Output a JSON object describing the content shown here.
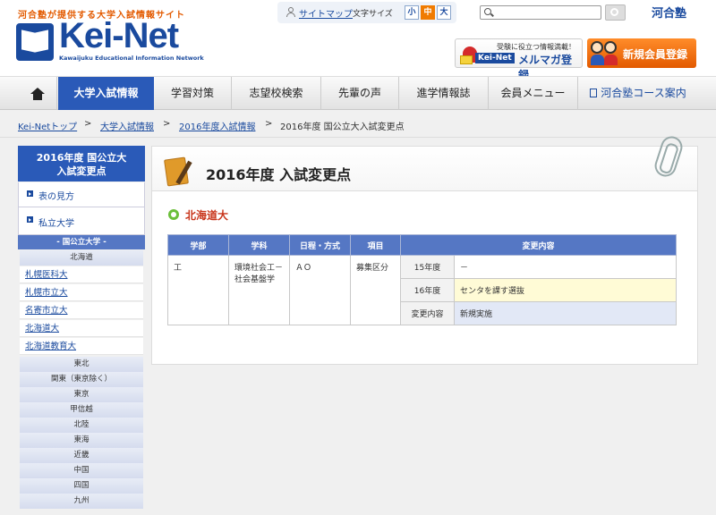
{
  "header": {
    "tagline": "河合塾が提供する大学入試情報サイト",
    "logo_text": "Kei-Net",
    "logo_sub": "Kawaijuku Educational Information Network",
    "sitemap": "サイトマップ",
    "fontsize_label": "文字サイズ",
    "fontsize_small": "小",
    "fontsize_mid": "中",
    "fontsize_large": "大",
    "search_value": "",
    "corp_logo": "河合塾",
    "mailmag_sub": "受験に役立つ情報満載！",
    "mailmag_keinet": "Kei-Net",
    "mailmag_label": "メルマガ登録",
    "register_label": "新規会員登録",
    "accent": "#2a5ab8",
    "orange": "#e35a00"
  },
  "nav": {
    "items": [
      "大学入試情報",
      "学習対策",
      "志望校検索",
      "先輩の声",
      "進学情報誌",
      "会員メニュー",
      "河合塾コース案内"
    ]
  },
  "breadcrumb": {
    "items": [
      "Kei-Netトップ",
      "大学入試情報",
      "2016年度入試情報",
      "2016年度 国公立大入試変更点"
    ],
    "sep": ">"
  },
  "sidebar": {
    "title_line1": "2016年度 国公立大",
    "title_line2": "入試変更点",
    "link_hyo": "表の見方",
    "link_private": "私立大学",
    "national_header": "- 国公立大学 -",
    "regions_top": [
      "北海道"
    ],
    "univs": [
      "札幌医科大",
      "札幌市立大",
      "名寄市立大",
      "北海道大",
      "北海道教育大"
    ],
    "regions": [
      "東北",
      "関東（東京除く）",
      "東京",
      "甲信越",
      "北陸",
      "東海",
      "近畿",
      "中国",
      "四国",
      "九州"
    ]
  },
  "main": {
    "title": "2016年度 入試変更点",
    "univ_name": "北海道大",
    "table": {
      "headers": [
        "学部",
        "学科",
        "日程・方式",
        "項目",
        "変更内容"
      ],
      "faculty": "工",
      "department": "環境社会工－社会基盤学",
      "schedule": "ＡＯ",
      "item": "募集区分",
      "rows": [
        {
          "label": "15年度",
          "value": "－"
        },
        {
          "label": "16年度",
          "value": "センタを課す選抜"
        },
        {
          "label": "変更内容",
          "value": "新規実施"
        }
      ]
    }
  }
}
